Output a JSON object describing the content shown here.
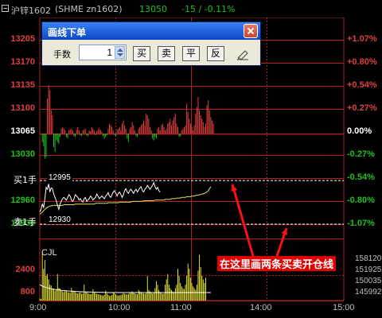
{
  "header": {
    "symbol_name": "沪锌1602",
    "symbol_code": "(SHME zn1602)",
    "last_price": "13050",
    "change": "-15 / -0.11%"
  },
  "colors": {
    "up": "#e04040",
    "down": "#20c020",
    "flat": "#ffffff",
    "price_line": "#ffffff",
    "avg_line": "#e0e060",
    "grid": "#b02020",
    "volume": "#e0e030",
    "annotation_bg": "#e00000"
  },
  "price_axis": {
    "left": [
      "13205",
      "13170",
      "13135",
      "13100",
      "13065",
      "13030",
      "12995",
      "12960",
      "12930"
    ],
    "right": [
      "+1.07%",
      "+0.80%",
      "+0.54%",
      "+0.27%",
      "0.00%",
      "-0.27%",
      "-0.54%",
      "-0.80%",
      "-1.07%"
    ]
  },
  "volume_axis": {
    "left": [
      "2400",
      "800"
    ],
    "right": [
      "158120",
      "151925",
      "150035",
      "145992"
    ]
  },
  "time_axis": [
    "9:00",
    "10:00",
    "11:00",
    "14:00",
    "15:00"
  ],
  "indicator_label": "CJL",
  "levels": {
    "sell_label": "买1手",
    "sell_price": "12995",
    "buy_label": "卖1手",
    "buy_price": "12930"
  },
  "annotation": "在这里画两条买卖开仓线",
  "dialog": {
    "title": "画线下单",
    "qty_label": "手数",
    "qty_value": "1",
    "buttons": [
      "买",
      "卖",
      "平",
      "反"
    ],
    "pen_icon": "pen-icon",
    "close_icon": "close-icon"
  },
  "chart_data": {
    "type": "line",
    "prev_close": 13065,
    "ylim": [
      12930,
      13205
    ],
    "series": [
      {
        "values": [
          12948,
          12952,
          12960,
          12955,
          12968,
          12985,
          12982,
          12990,
          12978,
          12984,
          12983,
          12975,
          12970,
          12965,
          12958,
          12952,
          12960,
          12965,
          12968,
          12970,
          12968,
          12966,
          12970,
          12974,
          12972,
          12966,
          12964,
          12968,
          12974,
          12972,
          12970,
          12966,
          12968,
          12965,
          12963,
          12968,
          12970,
          12964,
          12966,
          12968,
          12972,
          12970,
          12966,
          12968,
          12970,
          12975,
          12972,
          12968,
          12970,
          12972,
          12970,
          12968,
          12972,
          12974,
          12977,
          12972,
          12970,
          12974,
          12978,
          12980,
          12976,
          12972,
          12976,
          12978,
          12974,
          12970,
          12974,
          12980,
          12983,
          12978,
          12976,
          12980,
          12982,
          12979,
          12976,
          12980,
          12982,
          12978,
          12981,
          12984,
          12986,
          12980,
          12978,
          12982,
          12984,
          12988,
          12985,
          12982,
          12985,
          12988,
          12992,
          12986,
          12982,
          12985,
          12980,
          12978
        ]
      },
      {
        "values": [
          12945,
          12946,
          12948,
          12950,
          12952,
          12954,
          12955,
          12956,
          12957,
          12957,
          12958,
          12958,
          12958,
          12958,
          12958,
          12958,
          12958,
          12958,
          12958,
          12959,
          12959,
          12959,
          12959,
          12959,
          12959,
          12959,
          12959,
          12959,
          12960,
          12960,
          12960,
          12960,
          12960,
          12960,
          12960,
          12960,
          12960,
          12960,
          12960,
          12960,
          12960,
          12960,
          12960,
          12960,
          12961,
          12961,
          12961,
          12961,
          12961,
          12961,
          12961,
          12961,
          12961,
          12961,
          12962,
          12962,
          12962,
          12962,
          12962,
          12962,
          12962,
          12962,
          12962,
          12963,
          12963,
          12963,
          12963,
          12963,
          12963,
          12963,
          12963,
          12963,
          12963,
          12964,
          12964,
          12964,
          12964,
          12964,
          12964,
          12964,
          12964,
          12964,
          12965,
          12965,
          12965,
          12965,
          12965,
          12965,
          12965,
          12965,
          12965,
          12966,
          12966,
          12966,
          12966,
          12966,
          12966,
          12966,
          12966,
          12967,
          12967,
          12967,
          12967,
          12967,
          12968,
          12968,
          12968,
          12968,
          12969,
          12969,
          12969,
          12969,
          12970,
          12970,
          12970,
          12970,
          12971,
          12971,
          12971,
          12971,
          12972,
          12972,
          12972,
          12973,
          12973,
          12973,
          12974,
          12974,
          12975,
          12975,
          12976,
          12977,
          12978,
          12980,
          12983,
          12986
        ]
      }
    ],
    "breadth": [
      0,
      0,
      -10,
      -15,
      -30,
      -28,
      42,
      58,
      52,
      28,
      22,
      -16,
      -22,
      -8,
      -10,
      -12,
      -4,
      6,
      8,
      6,
      4,
      -4,
      -6,
      4,
      5,
      6,
      4,
      -3,
      -4,
      5,
      8,
      4,
      -2,
      -3,
      4,
      5,
      6,
      -2,
      -3,
      4,
      3,
      8,
      6,
      4,
      -2,
      3,
      5,
      7,
      4,
      2,
      -3,
      -6,
      -4,
      -2,
      6,
      12,
      10,
      8,
      4,
      -2,
      -3,
      5,
      6,
      8,
      4,
      12,
      16,
      10,
      6,
      -6,
      -10,
      6,
      8,
      14,
      10,
      4,
      -3,
      -4,
      6,
      8,
      10,
      12,
      16,
      10,
      24,
      22,
      18,
      8,
      4,
      -6,
      -8,
      -4,
      -6,
      6,
      8,
      4,
      10,
      12,
      8,
      4,
      6,
      12,
      14,
      18,
      10,
      16,
      20,
      24,
      12,
      8,
      -4,
      -3,
      4,
      6,
      8,
      10,
      36,
      26,
      18,
      12,
      8,
      4,
      10,
      24,
      32,
      44,
      28,
      22,
      18,
      14,
      8,
      12,
      34,
      40,
      28,
      20,
      16,
      12
    ],
    "volume": [
      120,
      90,
      2700,
      1800,
      2300,
      1400,
      1500,
      1200,
      900,
      850,
      700,
      650,
      550,
      600,
      1500,
      720,
      680,
      560,
      520,
      480,
      600,
      520,
      480,
      460,
      430,
      720,
      560,
      500,
      480,
      420,
      400,
      440,
      460,
      380,
      400,
      900,
      500,
      460,
      420,
      380,
      360,
      380,
      640,
      480,
      420,
      380,
      360,
      340,
      320,
      300,
      280,
      340,
      560,
      400,
      320,
      280,
      260,
      320,
      460,
      420,
      360,
      300,
      280,
      300,
      320,
      340,
      420,
      380,
      360,
      340,
      380,
      420,
      460,
      520,
      440,
      400,
      380,
      360,
      600,
      520,
      460,
      420,
      400,
      380,
      420,
      1400,
      600,
      520,
      480,
      400,
      440,
      700,
      1100,
      900,
      600,
      480,
      420,
      380,
      400,
      900,
      1200,
      1500,
      900,
      700,
      600,
      520,
      460,
      700,
      900,
      1800,
      1400,
      1000,
      800,
      700,
      650,
      900,
      1400,
      2100,
      1800,
      1300,
      1000,
      800,
      700,
      600,
      900,
      1700,
      2600,
      1900,
      1400,
      1200,
      1000,
      1300
    ],
    "volume_avg": [
      900,
      860,
      820,
      790,
      760,
      740,
      720,
      700,
      680,
      660,
      650,
      640,
      630,
      620,
      610,
      600,
      590,
      580,
      570,
      560,
      555,
      550,
      545,
      540,
      535,
      530,
      525,
      520,
      515,
      510,
      505,
      500,
      498,
      495,
      492,
      490,
      488,
      486,
      484,
      482,
      480,
      478,
      476,
      474,
      472,
      470,
      468,
      466,
      464,
      462,
      460,
      458,
      456,
      454,
      452,
      450,
      450,
      450,
      450,
      450,
      450,
      450,
      450,
      450,
      450,
      450,
      450,
      450,
      450,
      450,
      450,
      450,
      450,
      450,
      450,
      450,
      450,
      450,
      450,
      450,
      450,
      450,
      450,
      450,
      450,
      450,
      450,
      450,
      450,
      450,
      450,
      450,
      450,
      450,
      450,
      450,
      450,
      450,
      450,
      450,
      450,
      450,
      450,
      450,
      450,
      450,
      450,
      450,
      450,
      450,
      450,
      450,
      450,
      450,
      450,
      450,
      450,
      450,
      450,
      450,
      450,
      450,
      450,
      450,
      450,
      450,
      450,
      450,
      450,
      450,
      450,
      450,
      450,
      450,
      450,
      450
    ]
  }
}
